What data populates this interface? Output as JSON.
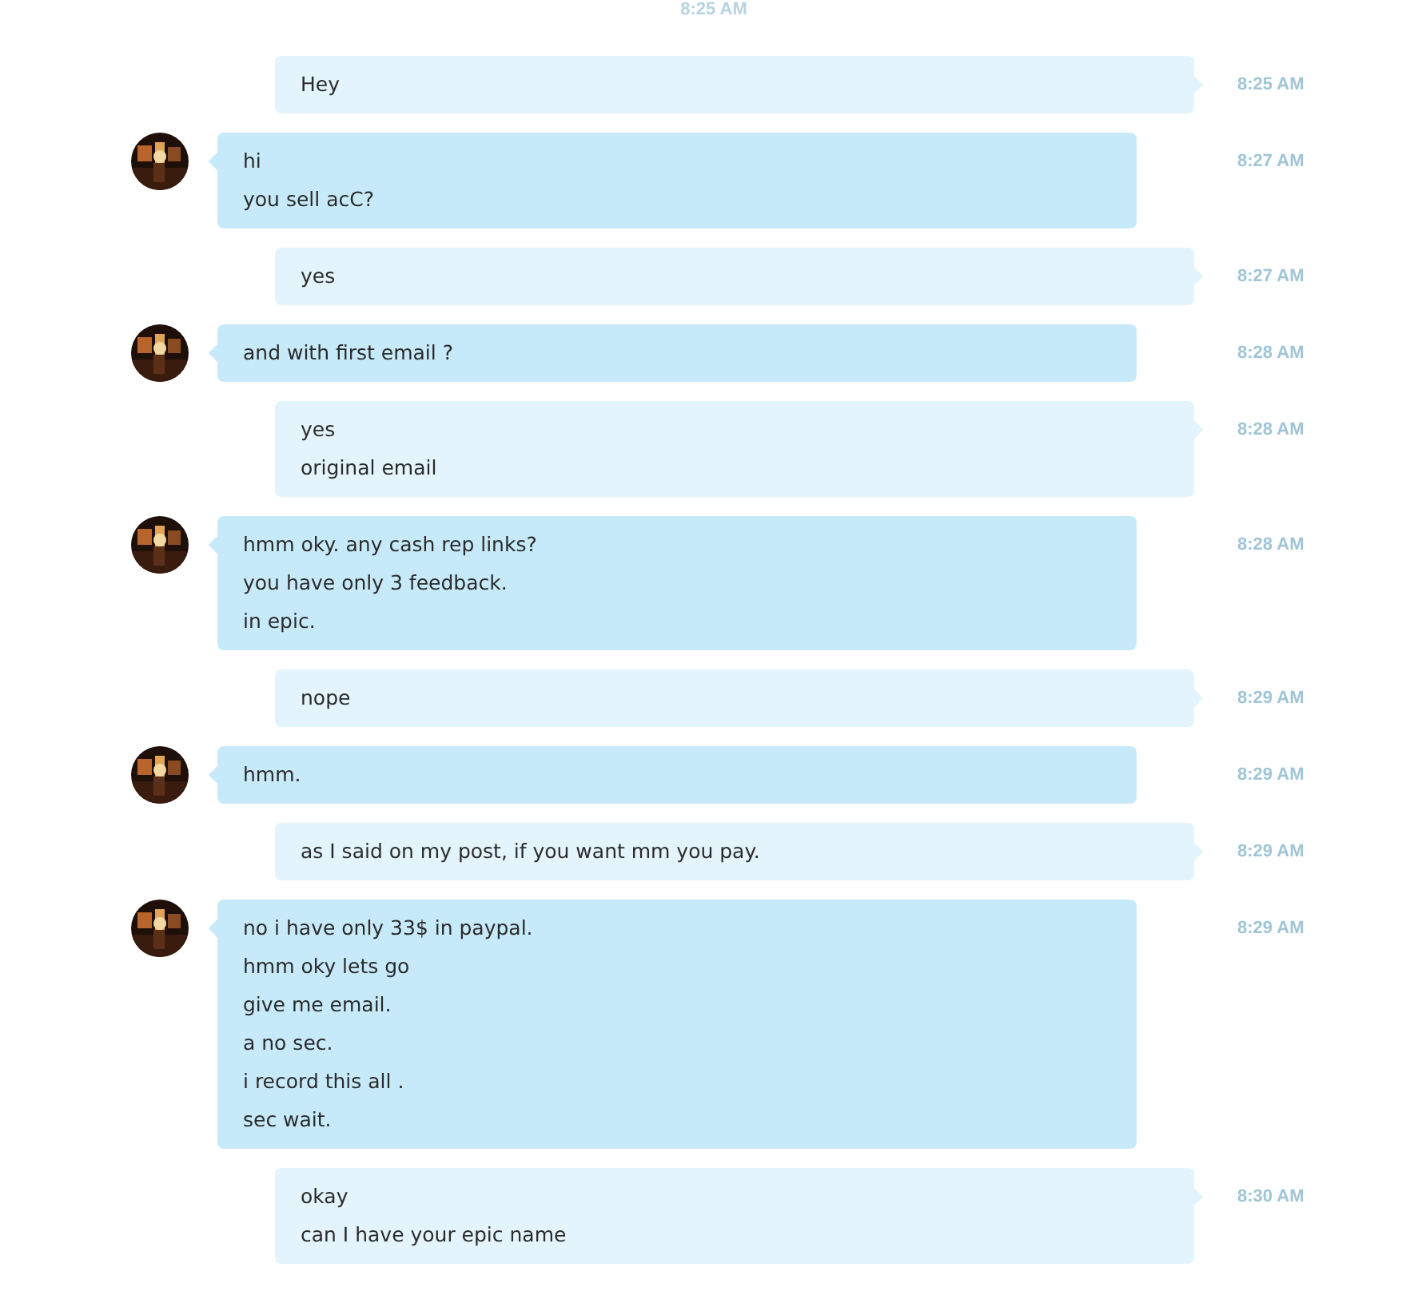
{
  "date_header": "8:25 AM",
  "messages": [
    {
      "kind": "sent",
      "lines": [
        "Hey"
      ],
      "time": "8:25 AM"
    },
    {
      "kind": "received",
      "lines": [
        "hi",
        "you sell acC?"
      ],
      "time": "8:27 AM"
    },
    {
      "kind": "sent",
      "lines": [
        "yes"
      ],
      "time": "8:27 AM"
    },
    {
      "kind": "received",
      "lines": [
        "and with first email ?"
      ],
      "time": "8:28 AM"
    },
    {
      "kind": "sent",
      "lines": [
        "yes",
        "original email"
      ],
      "time": "8:28 AM"
    },
    {
      "kind": "received",
      "lines": [
        "hmm oky. any cash rep links?",
        "you have only 3 feedback.",
        "in epic."
      ],
      "time": "8:28 AM"
    },
    {
      "kind": "sent",
      "lines": [
        "nope"
      ],
      "time": "8:29 AM"
    },
    {
      "kind": "received",
      "lines": [
        "hmm."
      ],
      "time": "8:29 AM"
    },
    {
      "kind": "sent",
      "lines": [
        "as I said on my post, if you want mm you pay."
      ],
      "time": "8:29 AM"
    },
    {
      "kind": "received",
      "lines": [
        "no i have only 33$ in paypal.",
        "hmm oky lets go",
        "give me email.",
        "a no sec.",
        "i record this all .",
        "sec wait."
      ],
      "time": "8:29 AM"
    },
    {
      "kind": "sent",
      "lines": [
        "okay",
        "can I have your epic name"
      ],
      "time": "8:30 AM"
    }
  ]
}
